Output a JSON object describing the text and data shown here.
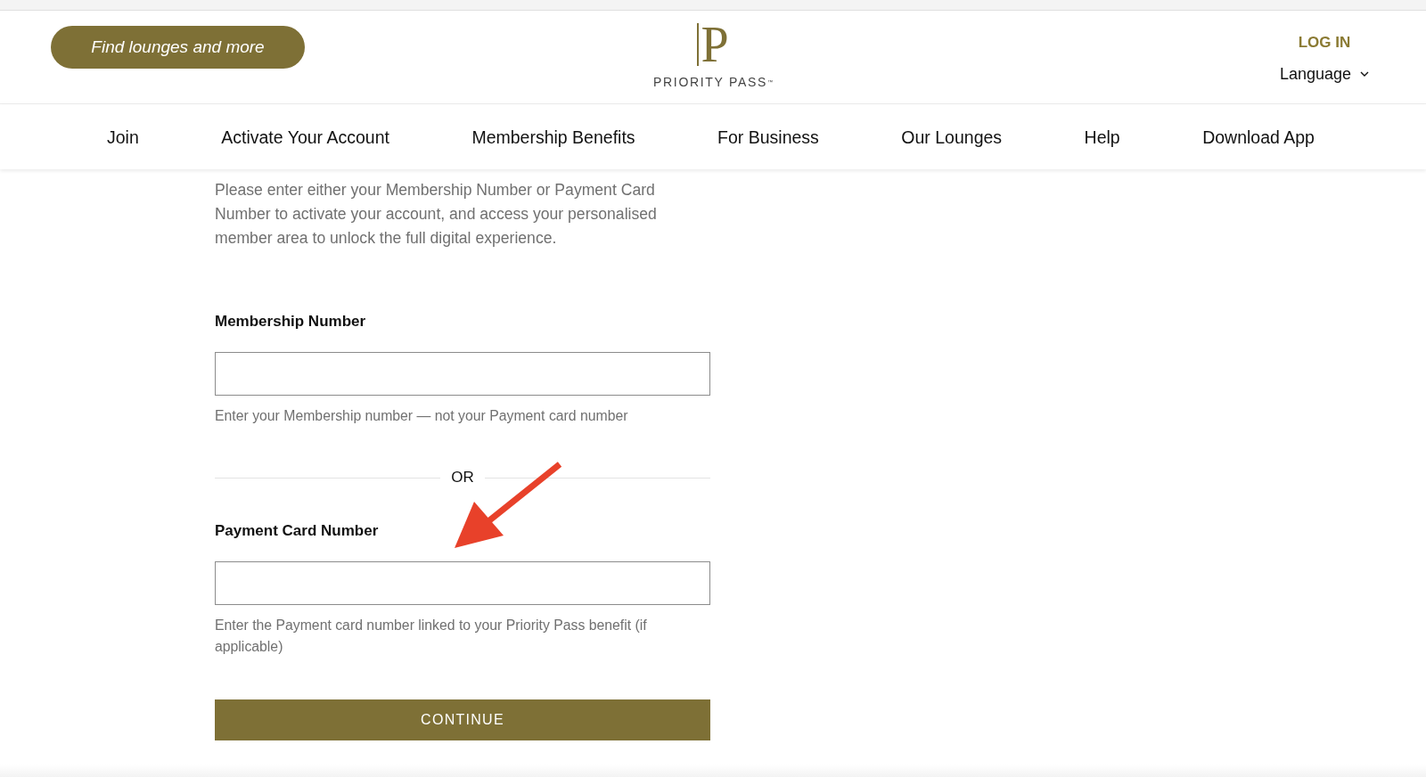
{
  "header": {
    "search_button": "Find lounges and more",
    "logo": {
      "mark": "P",
      "wordmark": "PRIORITY PASS$^{™}$"
    },
    "login": "LOG IN",
    "language": "Language"
  },
  "nav": [
    {
      "label": "Join"
    },
    {
      "label": "Activate Your Account"
    },
    {
      "label": "Membership Benefits"
    },
    {
      "label": "For Business"
    },
    {
      "label": "Our Lounges"
    },
    {
      "label": "Help"
    },
    {
      "label": "Download App"
    }
  ],
  "form": {
    "intro": "Please enter either your Membership Number or Payment Card Number to activate your account, and access your personalised member area to unlock the full digital experience.",
    "fields": [
      {
        "label": "Membership Number",
        "hint": "Enter your Membership number — not your Payment card number"
      },
      {
        "label": "Payment Card Number",
        "hint": "Enter the Payment card number linked to your Priority Pass benefit (if applicable)"
      }
    ],
    "divider": "OR",
    "submit": "CONTINUE"
  }
}
